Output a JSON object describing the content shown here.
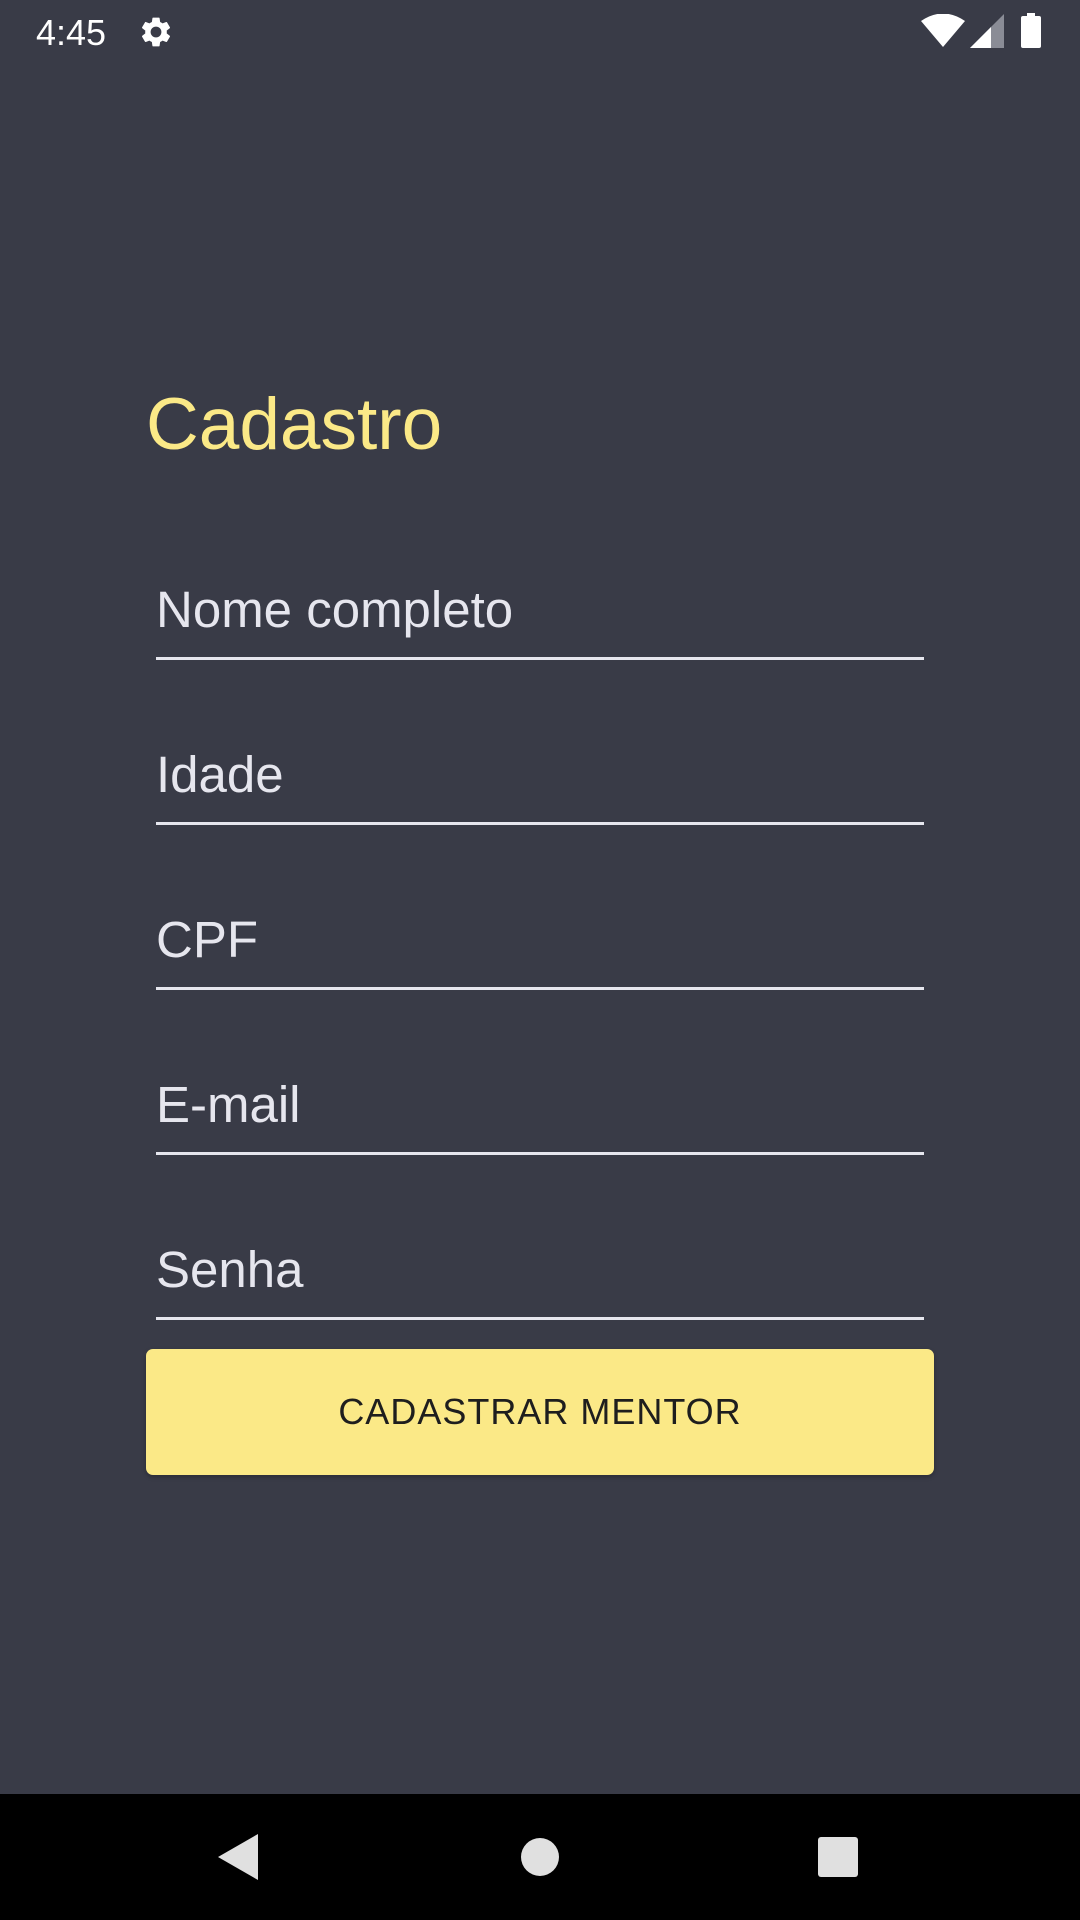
{
  "status_bar": {
    "time": "4:45",
    "icons": [
      "gear-icon",
      "wifi-icon",
      "cell-signal-icon",
      "battery-icon"
    ]
  },
  "form": {
    "title": "Cadastro",
    "fields": [
      {
        "name": "full-name",
        "placeholder": "Nome completo",
        "value": ""
      },
      {
        "name": "age",
        "placeholder": "Idade",
        "value": ""
      },
      {
        "name": "cpf",
        "placeholder": "CPF",
        "value": ""
      },
      {
        "name": "email",
        "placeholder": "E-mail",
        "value": ""
      },
      {
        "name": "password",
        "placeholder": "Senha",
        "value": ""
      }
    ],
    "submit_label": "CADASTRAR MENTOR"
  },
  "nav_bar": {
    "icons": [
      "back-icon",
      "home-icon",
      "recents-icon"
    ]
  },
  "colors": {
    "background": "#393b47",
    "accent": "#fbe987",
    "field_text": "#e6e6ee",
    "nav_background": "#000000"
  }
}
